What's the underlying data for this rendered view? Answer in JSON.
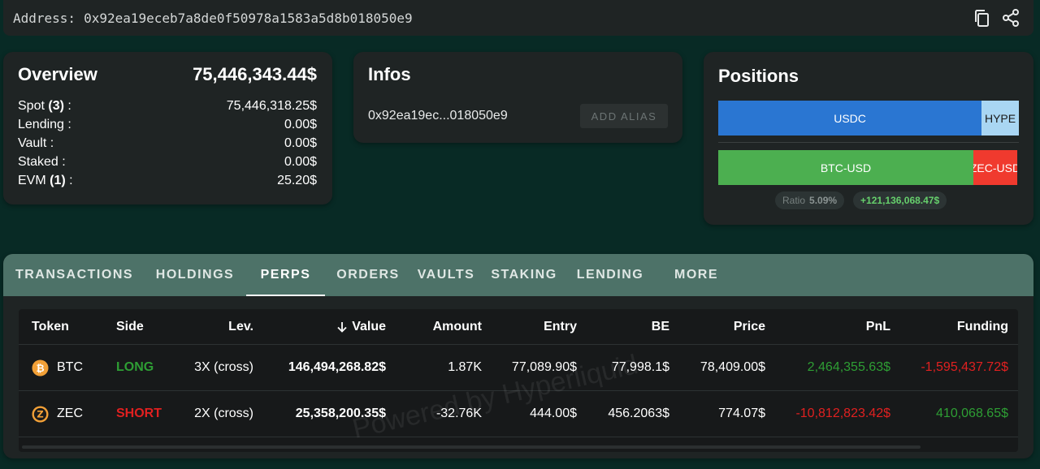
{
  "address": {
    "label": "Address:",
    "value": "0x92ea19eceb7a8de0f50978a1583a5d8b018050e9",
    "copy_icon": "copy-icon",
    "share_icon": "share-icon"
  },
  "overview": {
    "title": "Overview",
    "total": "75,446,343.44$",
    "rows": [
      {
        "label": "Spot",
        "count": "(3)",
        "colon": " :",
        "value": "75,446,318.25$"
      },
      {
        "label": "Lending :",
        "count": "",
        "colon": "",
        "value": "0.00$"
      },
      {
        "label": "Vault :",
        "count": "",
        "colon": "",
        "value": "0.00$"
      },
      {
        "label": "Staked :",
        "count": "",
        "colon": "",
        "value": "0.00$"
      },
      {
        "label": "EVM",
        "count": "(1)",
        "colon": " :",
        "value": "25.20$"
      }
    ]
  },
  "infos": {
    "title": "Infos",
    "short_address": "0x92ea19ec...018050e9",
    "add_alias_label": "ADD ALIAS"
  },
  "positions": {
    "title": "Positions",
    "spot_bar": [
      {
        "label": "USDC",
        "share": 0.876,
        "color": "#2a76d2",
        "text_color": "#ffffff"
      },
      {
        "label": "HYPE",
        "share": 0.124,
        "color": "#a9d6f3",
        "text_color": "#1a1a1a"
      }
    ],
    "perp_bar": [
      {
        "label": "BTC-USD",
        "share": 0.853,
        "color": "#4caf50",
        "text_color": "#ffffff"
      },
      {
        "label": "ZEC-USD",
        "share": 0.147,
        "color": "#f03a2e",
        "text_color": "#ffffff"
      }
    ],
    "ratio_label": "Ratio",
    "ratio_value": "5.09%",
    "pnl_value": "+121,136,068.47$"
  },
  "tabs": [
    {
      "label": "TRANSACTIONS",
      "active": false
    },
    {
      "label": "HOLDINGS",
      "active": false
    },
    {
      "label": "PERPS",
      "active": true
    },
    {
      "label": "ORDERS",
      "active": false
    },
    {
      "label": "VAULTS",
      "active": false
    },
    {
      "label": "STAKING",
      "active": false
    },
    {
      "label": "LENDING",
      "active": false
    },
    {
      "label": "MORE",
      "active": false
    }
  ],
  "table": {
    "headers": {
      "token": "Token",
      "side": "Side",
      "lev": "Lev.",
      "value": "Value",
      "amount": "Amount",
      "entry": "Entry",
      "be": "BE",
      "price": "Price",
      "pnl": "PnL",
      "funding": "Funding"
    },
    "sort_icon": "arrow-down-icon",
    "rows": [
      {
        "token": "BTC",
        "icon": "bitcoin-icon",
        "icon_color": "#f2a037",
        "side": "LONG",
        "side_color": "#2e9e34",
        "lev": "3X (cross)",
        "value": "146,494,268.82$",
        "amount": "1.87K",
        "entry": "77,089.90$",
        "be": "77,998.1$",
        "price": "78,409.00$",
        "pnl": "2,464,355.63$",
        "pnl_color": "#2e9e34",
        "funding": "-1,595,437.72$",
        "funding_color": "#e02020"
      },
      {
        "token": "ZEC",
        "icon": "zcash-icon",
        "icon_color": "#f2a037",
        "side": "SHORT",
        "side_color": "#e02020",
        "lev": "2X (cross)",
        "value": "25,358,200.35$",
        "amount": "-32.76K",
        "entry": "444.00$",
        "be": "456.2063$",
        "price": "774.07$",
        "pnl": "-10,812,823.42$",
        "pnl_color": "#e02020",
        "funding": "410,068.65$",
        "funding_color": "#2e9e34"
      }
    ]
  },
  "watermark": "Powered by Hyperliquid"
}
